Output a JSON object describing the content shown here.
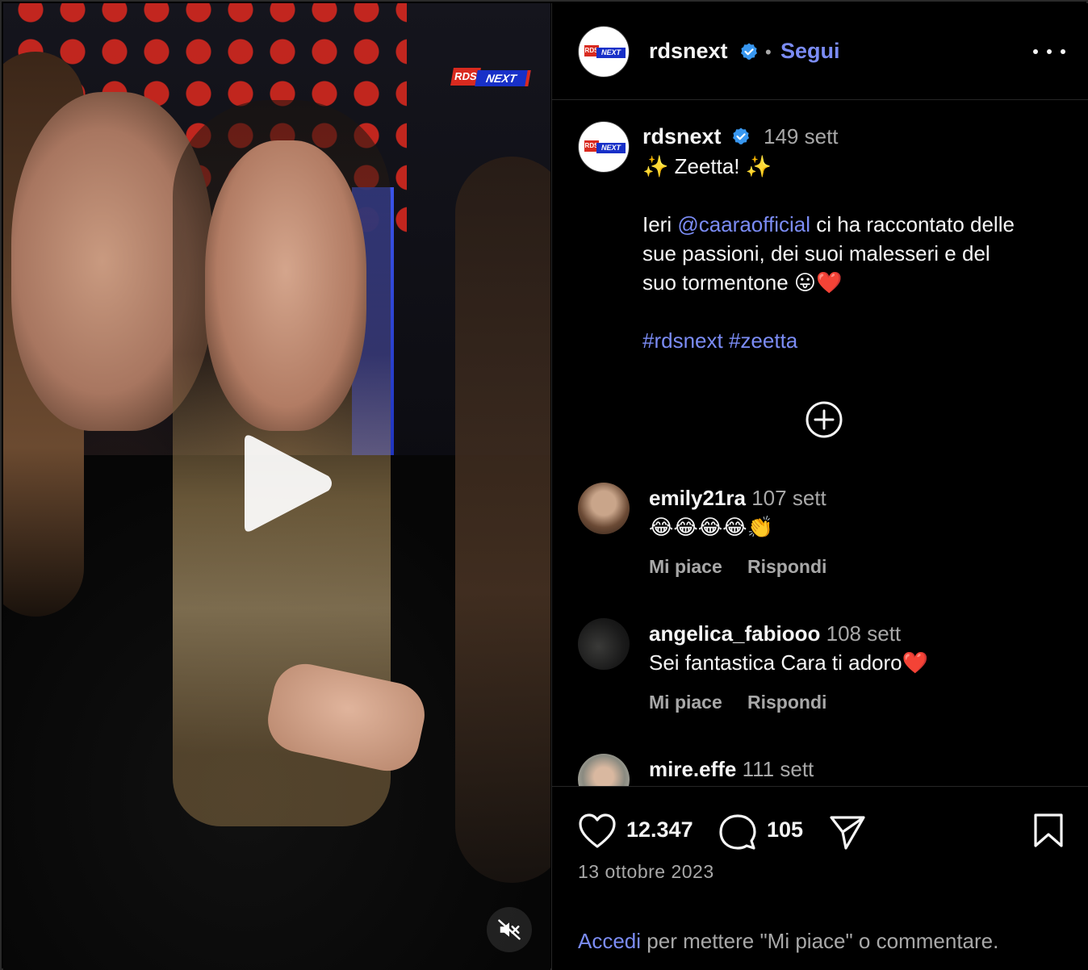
{
  "video": {
    "badge_rds": "RDS",
    "badge_next": "NEXT"
  },
  "header": {
    "username": "rdsnext",
    "separator": "•",
    "follow_label": "Segui"
  },
  "post": {
    "username": "rdsnext",
    "time": "149 sett",
    "caption_line1": "✨ Zeetta! ✨",
    "caption_p2_before": "Ieri ",
    "caption_mention": "@caaraofficial",
    "caption_p2_after": " ci ha raccontato delle",
    "caption_line3": "sue passioni, dei suoi malesseri e del",
    "caption_line4": "suo tormentone 😛❤️",
    "hashtag1": "#rdsnext",
    "hashtag2": "#zeetta"
  },
  "comments": [
    {
      "user": "emily21ra",
      "time": "107 sett",
      "text": "😂😂😂😂👏",
      "like": "Mi piace",
      "reply": "Rispondi"
    },
    {
      "user": "angelica_fabiooo",
      "time": "108 sett",
      "text": "Sei fantastica Cara ti adoro❤️",
      "like": "Mi piace",
      "reply": "Rispondi"
    },
    {
      "user": "mire.effe",
      "time": "111 sett"
    }
  ],
  "footer": {
    "likes": "12.347",
    "comments": "105",
    "date": "13 ottobre 2023",
    "login_link": "Accedi",
    "login_text": " per mettere \"Mi piace\" o commentare."
  },
  "colors": {
    "accent_link": "#7b8cf5",
    "verified": "#3897f0",
    "muted": "#a8a8a8",
    "background": "#000000"
  },
  "icons": [
    "play-icon",
    "mute-icon",
    "verified-badge-icon",
    "more-options-icon",
    "add-circle-icon",
    "heart-icon",
    "comment-icon",
    "share-icon",
    "bookmark-icon"
  ]
}
